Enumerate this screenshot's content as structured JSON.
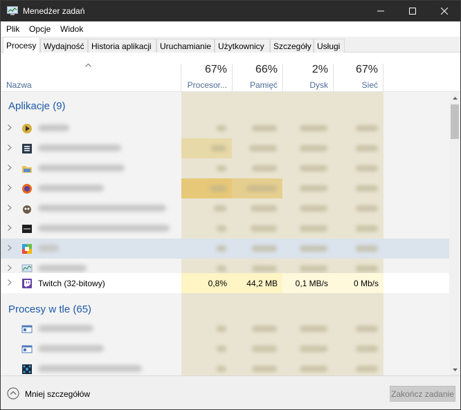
{
  "window": {
    "title": "Menedżer zadań"
  },
  "menu": {
    "items": [
      "Plik",
      "Opcje",
      "Widok"
    ]
  },
  "tabs": [
    "Procesy",
    "Wydajność",
    "Historia aplikacji",
    "Uruchamianie",
    "Użytkownicy",
    "Szczegóły",
    "Usługi"
  ],
  "active_tab": "Procesy",
  "columns": {
    "name": "Nazwa",
    "cpu": {
      "percent": "67%",
      "label": "Procesor..."
    },
    "memory": {
      "percent": "66%",
      "label": "Pamięć"
    },
    "disk": {
      "percent": "2%",
      "label": "Dysk"
    },
    "network": {
      "percent": "67%",
      "label": "Sieć"
    }
  },
  "groups": {
    "apps": "Aplikacje (9)",
    "background": "Procesy w tle (65)"
  },
  "highlighted_process": {
    "name": "Twitch (32-bitowy)",
    "cpu": "0,8%",
    "memory": "44,2 MB",
    "disk": "0,1 MB/s",
    "network": "0 Mb/s"
  },
  "footer": {
    "less_details": "Mniej szczegółów",
    "end_task": "Zakończ zadanie"
  },
  "colors": {
    "titlebar": "#2b2b2b",
    "group_title": "#1e5aa8",
    "heat_light": "#fff4c4",
    "twitch_purple": "#6441a5"
  }
}
